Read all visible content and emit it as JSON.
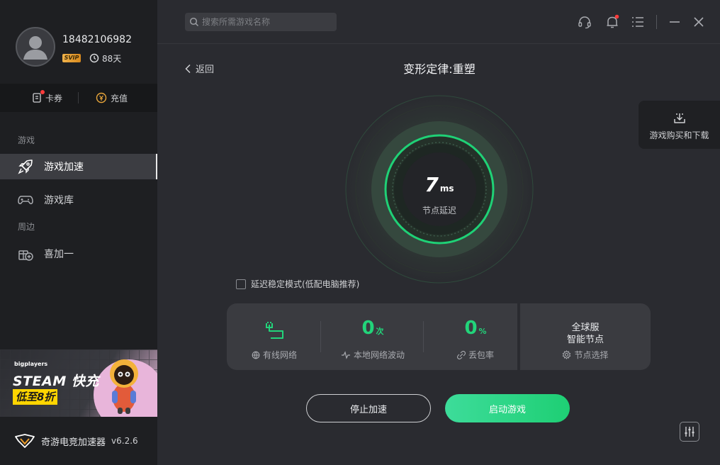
{
  "user": {
    "phone": "18482106982",
    "vip_badge": "SVIP",
    "days": "88天"
  },
  "wallet": {
    "coupon_label": "卡券",
    "recharge_label": "充值"
  },
  "sidebar": {
    "section_games": "游戏",
    "items": [
      {
        "label": "游戏加速"
      },
      {
        "label": "游戏库"
      }
    ],
    "section_nearby": "周边",
    "nearby_items": [
      {
        "label": "喜加一"
      }
    ]
  },
  "banner": {
    "brand": "bigplayers",
    "title": "STEAM 快充",
    "subtitle": "低至8折"
  },
  "footer": {
    "app_name": "奇游电竞加速器",
    "version": "v6.2.6"
  },
  "topbar": {
    "search_placeholder": "搜索所需游戏名称"
  },
  "main": {
    "back_label": "返回",
    "game_title": "变形定律:重塑",
    "side_tab_label": "游戏购买和下载",
    "latency_value": "7",
    "latency_unit": "ms",
    "latency_label": "节点延迟",
    "stable_mode_label": "延迟稳定模式(低配电脑推荐)",
    "stats": {
      "network_label": "有线网络",
      "fluctuation_value": "0",
      "fluctuation_unit": "次",
      "fluctuation_label": "本地网络波动",
      "loss_value": "0",
      "loss_unit": "%",
      "loss_label": "丢包率"
    },
    "node": {
      "line1": "全球服",
      "line2": "智能节点",
      "label": "节点选择"
    },
    "stop_button": "停止加速",
    "start_button": "启动游戏"
  },
  "colors": {
    "accent": "#22d47a",
    "sidebar_bg": "#1e1f22",
    "main_bg": "#2a2b30"
  }
}
